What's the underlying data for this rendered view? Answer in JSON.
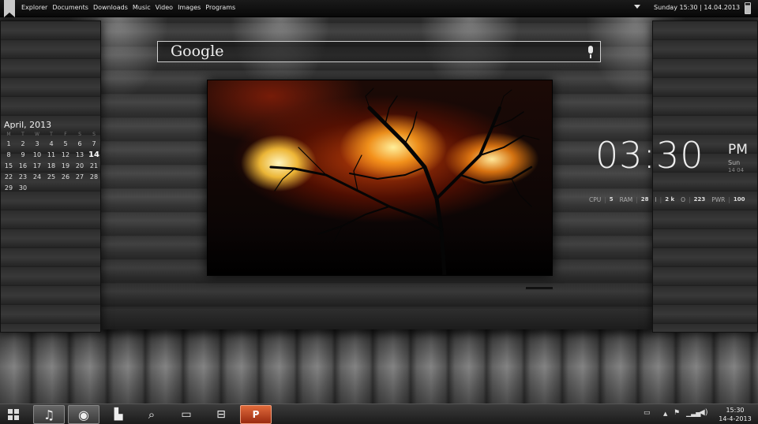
{
  "topbar": {
    "menu": [
      "Explorer",
      "Documents",
      "Downloads",
      "Music",
      "Video",
      "Images",
      "Programs"
    ],
    "clock": "Sunday 15:30 | 14.04.2013"
  },
  "search": {
    "label": "Google"
  },
  "calendar": {
    "title": "April, 2013",
    "weekdays": [
      "M",
      "T",
      "W",
      "T",
      "F",
      "S",
      "S"
    ],
    "days": [
      "1",
      "2",
      "3",
      "4",
      "5",
      "6",
      "7",
      "8",
      "9",
      "10",
      "11",
      "12",
      "13",
      "14",
      "15",
      "16",
      "17",
      "18",
      "19",
      "20",
      "21",
      "22",
      "23",
      "24",
      "25",
      "26",
      "27",
      "28",
      "29",
      "30"
    ],
    "today": "14"
  },
  "clock": {
    "time": "03:30",
    "ampm": "PM",
    "day": "Sun",
    "date": "14 04"
  },
  "stats": [
    {
      "label": "CPU",
      "value": "5"
    },
    {
      "label": "RAM",
      "value": "28"
    },
    {
      "label": "I",
      "value": "2 k"
    },
    {
      "label": "O",
      "value": "223"
    },
    {
      "label": "PWR",
      "value": "100"
    }
  ],
  "taskbar": {
    "apps": [
      {
        "name": "music-icon",
        "glyph": "♫"
      },
      {
        "name": "chrome-icon",
        "glyph": "◉"
      },
      {
        "name": "store-icon",
        "glyph": "▙"
      },
      {
        "name": "search-files-icon",
        "glyph": "⌕"
      },
      {
        "name": "video-icon",
        "glyph": "▭"
      },
      {
        "name": "settings-icon",
        "glyph": "⊟"
      },
      {
        "name": "powerpoint-icon",
        "glyph": "P"
      }
    ],
    "tray_time": "15:30",
    "tray_date": "14-4-2013"
  },
  "colors": {
    "accent": "#e06a3a",
    "text": "#eeeeee"
  }
}
